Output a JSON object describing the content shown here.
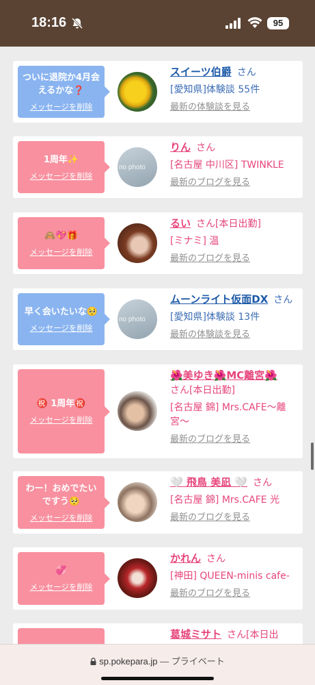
{
  "status_bar": {
    "time": "18:16",
    "battery": "95"
  },
  "cards": [
    {
      "bubble_color": "blue",
      "message": "ついに退院か4月会えるかな❓",
      "delete_label": "メッセージを削除",
      "avatar": "yellow-flower",
      "name": "スイーツ伯爵",
      "name_suffix": "さん",
      "tag": "",
      "line2": "[愛知県]体験談 55件",
      "line3": "",
      "more_link": "最新の体験談を見る"
    },
    {
      "bubble_color": "pink",
      "message": "1周年✨",
      "delete_label": "メッセージを削除",
      "avatar": "no-photo",
      "avatar_text": "no photo",
      "name": "りん",
      "name_suffix": "さん",
      "tag": "",
      "line2": "[名古屋 中川区] TWINKLE",
      "line3": "",
      "more_link": "最新のブログを見る"
    },
    {
      "bubble_color": "pink",
      "message": "🙈💖🎁",
      "delete_label": "メッセージを削除",
      "avatar": "dog-filter-portrait",
      "name": "るい",
      "name_suffix": "さん",
      "tag": "[本日出勤]",
      "line2": "[ミナミ] 温",
      "line3": "",
      "more_link": "最新のブログを見る"
    },
    {
      "bubble_color": "blue",
      "message": "早く会いたいな🥺",
      "delete_label": "メッセージを削除",
      "avatar": "no-photo",
      "avatar_text": "no photo",
      "name": "ムーンライト仮面DX",
      "name_suffix": "さん",
      "tag": "",
      "line2": "[愛知県]体験談 13件",
      "line3": "",
      "more_link": "最新の体験談を見る"
    },
    {
      "bubble_color": "pink",
      "message": "㊗️ 1周年㊗️",
      "delete_label": "メッセージを削除",
      "avatar": "portrait",
      "name": "🌺美ゆき🌺MC離宮🌺",
      "name_suffix": "さん",
      "tag": "[本日出勤]",
      "line2": "[名古屋 錦] Mrs.CAFE～離",
      "line3": "宮～",
      "more_link": "最新のブログを見る"
    },
    {
      "bubble_color": "pink",
      "message": "わー！おめでたいですう🥺",
      "delete_label": "メッセージを削除",
      "avatar": "portrait",
      "name": "🤍 飛鳥 美凪 🤍",
      "name_suffix": "さん",
      "tag": "",
      "line2": "[名古屋 錦] Mrs.CAFE 光",
      "line3": "",
      "more_link": "最新のブログを見る"
    },
    {
      "bubble_color": "pink",
      "message": "💞",
      "delete_label": "メッセージを削除",
      "avatar": "portrait-red",
      "name": "かれん",
      "name_suffix": "さん",
      "tag": "",
      "line2": "[神田] QUEEN-minis cafe-",
      "line3": "",
      "more_link": "最新のブログを見る"
    },
    {
      "bubble_color": "pink",
      "message": "",
      "delete_label": "",
      "avatar": "",
      "name": "葛城ミサト",
      "name_suffix": "さん",
      "tag": "[本日出",
      "line2": "",
      "line3": "",
      "more_link": ""
    }
  ],
  "browser_bar": {
    "url": "sp.pokepara.jp",
    "mode": "— プライベート"
  }
}
